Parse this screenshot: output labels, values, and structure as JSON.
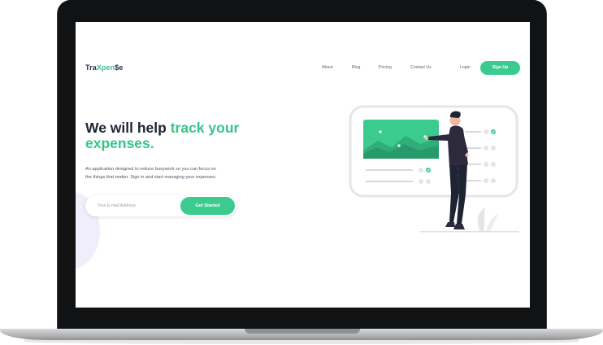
{
  "logo": {
    "part1": "Tra",
    "part2": "Xpen",
    "part3": "$e"
  },
  "nav": {
    "links": [
      "About",
      "Blog",
      "Pricing",
      "Contact Us",
      "Login"
    ],
    "signup_label": "Sign Up"
  },
  "hero": {
    "title_part1": "We will help ",
    "title_accent_1": "track your",
    "title_accent_2": "expenses.",
    "subtitle_line1": "An application designed to reduce busywork so you can focus on",
    "subtitle_line2": "the things that matter. Sign in and start managing your expenses."
  },
  "signup_form": {
    "email_placeholder": "Your E-mail Address",
    "cta_label": "Get Started"
  },
  "colors": {
    "accent": "#3ccb8f",
    "dark": "#1f2433",
    "laptop": "#111214"
  }
}
